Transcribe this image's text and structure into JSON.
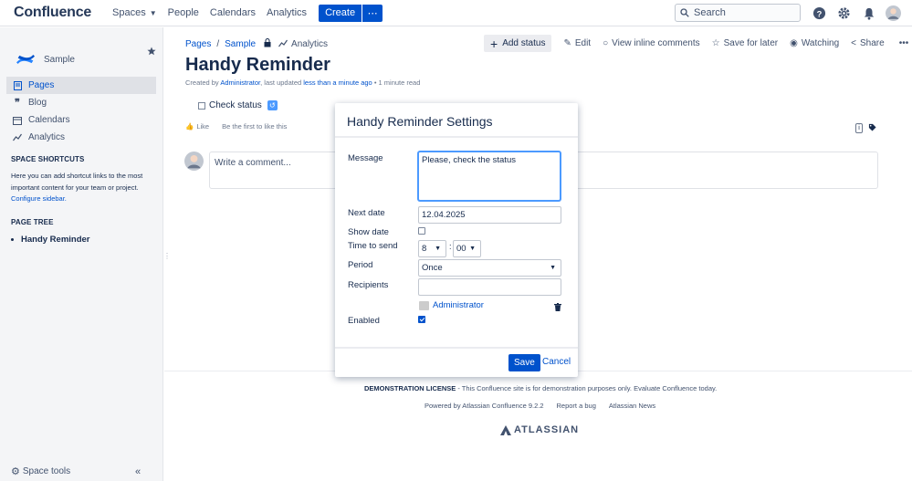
{
  "header": {
    "brand": "Confluence",
    "nav": [
      "Spaces",
      "People",
      "Calendars",
      "Analytics"
    ],
    "create_label": "Create",
    "search_placeholder": "Search"
  },
  "sidebar": {
    "space_name": "Sample",
    "items": [
      {
        "label": "Pages",
        "icon": "pages-icon",
        "active": true
      },
      {
        "label": "Blog",
        "icon": "blog-icon",
        "active": false
      },
      {
        "label": "Calendars",
        "icon": "calendar-icon",
        "active": false
      },
      {
        "label": "Analytics",
        "icon": "analytics-icon",
        "active": false
      }
    ],
    "shortcuts_title": "SPACE SHORTCUTS",
    "shortcuts_note": "Here you can add shortcut links to the most important content for your team or project.",
    "configure_link": "Configure sidebar.",
    "tree_title": "PAGE TREE",
    "tree_item": "Handy Reminder",
    "space_tools": "Space tools"
  },
  "breadcrumb": {
    "pages": "Pages",
    "space": "Sample",
    "analytics": "Analytics"
  },
  "page_actions": {
    "add_status": "Add status",
    "edit": "Edit",
    "view_comments": "View inline comments",
    "save_later": "Save for later",
    "watching": "Watching",
    "share": "Share"
  },
  "page": {
    "title": "Handy Reminder",
    "byline_prefix": "Created by ",
    "author": "Administrator",
    "byline_middle": ", last updated ",
    "updated": "less than a minute ago",
    "byline_suffix": " • 1 minute read",
    "check_status": "Check status",
    "like": "Like",
    "like_note": "Be the first to like this",
    "comment_placeholder": "Write a comment..."
  },
  "footer": {
    "license_bold": "DEMONSTRATION LICENSE",
    "license_text": " - This Confluence site is for demonstration purposes only. Evaluate Confluence today.",
    "powered": "Powered by Atlassian Confluence 9.2.2",
    "report": "Report a bug",
    "news": "Atlassian News",
    "atlassian": "ATLASSIAN"
  },
  "dialog": {
    "title": "Handy Reminder Settings",
    "message_label": "Message",
    "message_value": "Please, check the status",
    "next_date_label": "Next date",
    "next_date_value": "12.04.2025",
    "show_date_label": "Show date",
    "show_date_checked": false,
    "time_label": "Time to send",
    "time_hour": "8",
    "time_sep": ":",
    "time_minute": "00",
    "period_label": "Period",
    "period_value": "Once",
    "recipients_label": "Recipients",
    "recipient_name": "Administrator",
    "enabled_label": "Enabled",
    "enabled_checked": true,
    "save": "Save",
    "cancel": "Cancel"
  },
  "colors": {
    "primary": "#0052cc",
    "text": "#172b4d",
    "subtle": "#42526e"
  }
}
